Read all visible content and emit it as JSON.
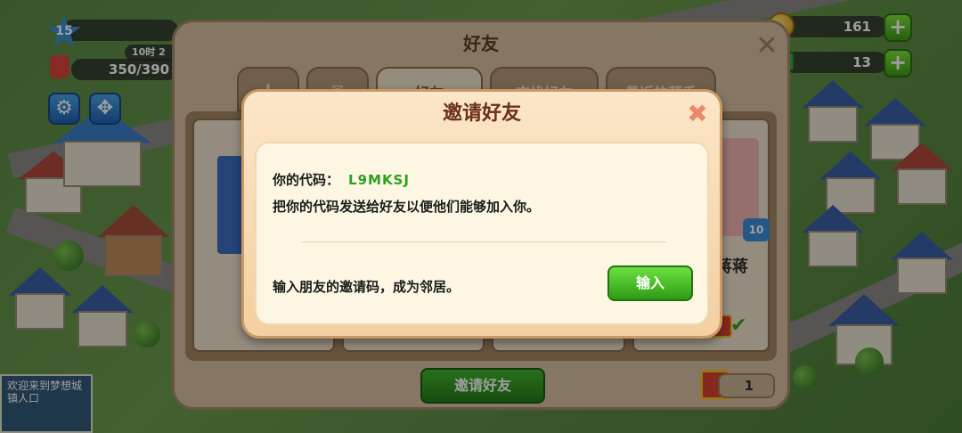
{
  "hud": {
    "level": "15",
    "population": "350/390",
    "timer": "10时 2",
    "coins": "161",
    "cash": "13"
  },
  "city": {
    "welcome_sign": "欢迎来到梦想城镇人口"
  },
  "friends_panel": {
    "title": "好友",
    "tabs": [
      {
        "label": "!"
      },
      {
        "label": "✉"
      },
      {
        "label": "好友"
      },
      {
        "label": "查找好友"
      },
      {
        "label": "最近的帮手"
      }
    ],
    "friend_card_label": "蒋蒋",
    "friend_card_level": "10",
    "invite_button": "邀请好友",
    "gift_count": "1"
  },
  "invite_dialog": {
    "title": "邀请好友",
    "code_label": "你的代码：",
    "code_value": "L9MKSJ",
    "share_text": "把你的代码发送给好友以便他们能够加入你。",
    "enter_prompt": "输入朋友的邀请码，成为邻居。",
    "enter_button": "输入"
  },
  "colors": {
    "code_green": "#2ea11f",
    "button_green": "#3aa51d",
    "dialog_title": "#6b2f1a",
    "panel_bg": "#d7c1a2"
  },
  "icons": [
    "star-level-icon",
    "avatar-icon",
    "gear-icon",
    "move-icon",
    "coin-icon",
    "cash-icon",
    "plus-icon",
    "close-icon",
    "gift-icon",
    "check-icon"
  ]
}
